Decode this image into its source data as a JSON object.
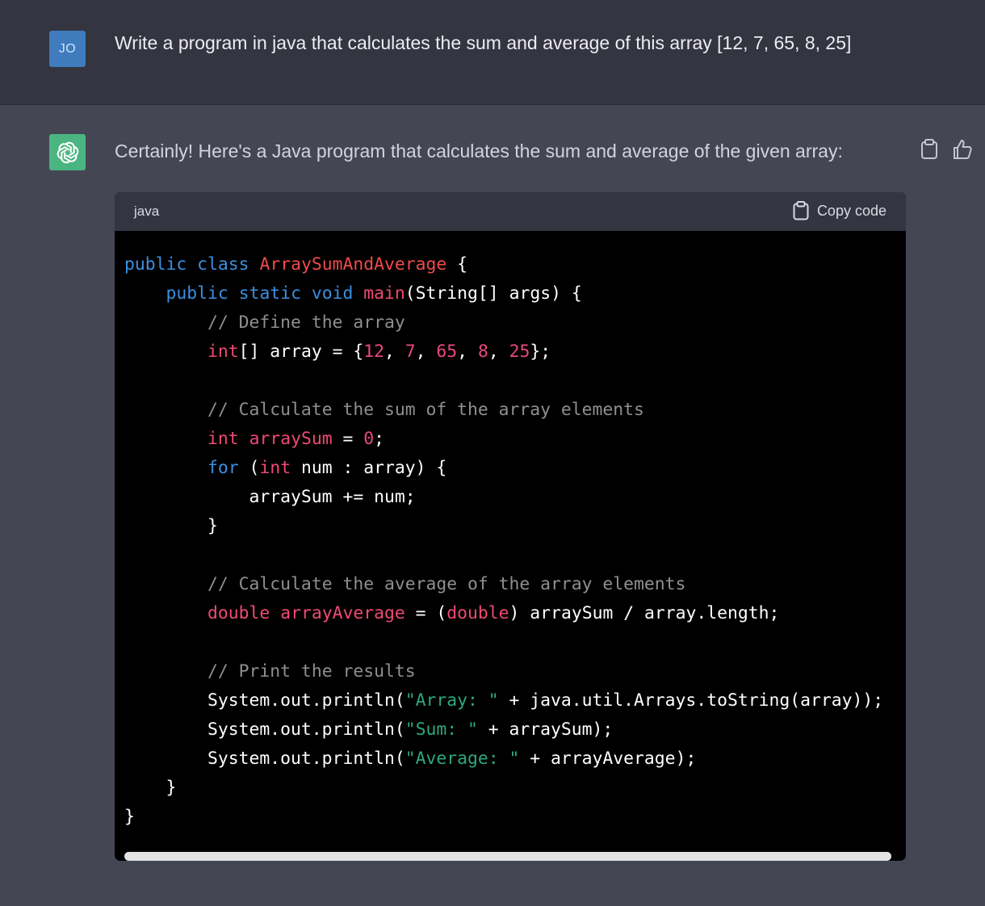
{
  "user_message": {
    "avatar_initials": "JO",
    "text": "Write a program in java that calculates the sum and average of this array [12, 7, 65, 8, 25]"
  },
  "assistant_message": {
    "intro": "Certainly! Here's a Java program that calculates the sum and average of the given array:",
    "code_block": {
      "language": "java",
      "copy_label": "Copy code",
      "lines": [
        [
          {
            "t": "kw",
            "v": "public"
          },
          {
            "t": "plain",
            "v": " "
          },
          {
            "t": "kw",
            "v": "class"
          },
          {
            "t": "plain",
            "v": " "
          },
          {
            "t": "cls",
            "v": "ArraySumAndAverage"
          },
          {
            "t": "plain",
            "v": " {"
          }
        ],
        [
          {
            "t": "plain",
            "v": "    "
          },
          {
            "t": "kw",
            "v": "public"
          },
          {
            "t": "plain",
            "v": " "
          },
          {
            "t": "kw",
            "v": "static"
          },
          {
            "t": "plain",
            "v": " "
          },
          {
            "t": "kw",
            "v": "void"
          },
          {
            "t": "plain",
            "v": " "
          },
          {
            "t": "type",
            "v": "main"
          },
          {
            "t": "plain",
            "v": "(String[] args) {"
          }
        ],
        [
          {
            "t": "plain",
            "v": "        "
          },
          {
            "t": "com",
            "v": "// Define the array"
          }
        ],
        [
          {
            "t": "plain",
            "v": "        "
          },
          {
            "t": "type",
            "v": "int"
          },
          {
            "t": "plain",
            "v": "[] array = {"
          },
          {
            "t": "num",
            "v": "12"
          },
          {
            "t": "plain",
            "v": ", "
          },
          {
            "t": "num",
            "v": "7"
          },
          {
            "t": "plain",
            "v": ", "
          },
          {
            "t": "num",
            "v": "65"
          },
          {
            "t": "plain",
            "v": ", "
          },
          {
            "t": "num",
            "v": "8"
          },
          {
            "t": "plain",
            "v": ", "
          },
          {
            "t": "num",
            "v": "25"
          },
          {
            "t": "plain",
            "v": "};"
          }
        ],
        [],
        [
          {
            "t": "plain",
            "v": "        "
          },
          {
            "t": "com",
            "v": "// Calculate the sum of the array elements"
          }
        ],
        [
          {
            "t": "plain",
            "v": "        "
          },
          {
            "t": "type",
            "v": "int"
          },
          {
            "t": "plain",
            "v": " "
          },
          {
            "t": "type",
            "v": "arraySum"
          },
          {
            "t": "plain",
            "v": " = "
          },
          {
            "t": "num",
            "v": "0"
          },
          {
            "t": "plain",
            "v": ";"
          }
        ],
        [
          {
            "t": "plain",
            "v": "        "
          },
          {
            "t": "kw",
            "v": "for"
          },
          {
            "t": "plain",
            "v": " ("
          },
          {
            "t": "type",
            "v": "int"
          },
          {
            "t": "plain",
            "v": " num : array) {"
          }
        ],
        [
          {
            "t": "plain",
            "v": "            arraySum += num;"
          }
        ],
        [
          {
            "t": "plain",
            "v": "        }"
          }
        ],
        [],
        [
          {
            "t": "plain",
            "v": "        "
          },
          {
            "t": "com",
            "v": "// Calculate the average of the array elements"
          }
        ],
        [
          {
            "t": "plain",
            "v": "        "
          },
          {
            "t": "type",
            "v": "double"
          },
          {
            "t": "plain",
            "v": " "
          },
          {
            "t": "type",
            "v": "arrayAverage"
          },
          {
            "t": "plain",
            "v": " = ("
          },
          {
            "t": "type",
            "v": "double"
          },
          {
            "t": "plain",
            "v": ") arraySum / array.length;"
          }
        ],
        [],
        [
          {
            "t": "plain",
            "v": "        "
          },
          {
            "t": "com",
            "v": "// Print the results"
          }
        ],
        [
          {
            "t": "plain",
            "v": "        System.out.println("
          },
          {
            "t": "str",
            "v": "\"Array: \""
          },
          {
            "t": "plain",
            "v": " + java.util.Arrays.toString(array));"
          }
        ],
        [
          {
            "t": "plain",
            "v": "        System.out.println("
          },
          {
            "t": "str",
            "v": "\"Sum: \""
          },
          {
            "t": "plain",
            "v": " + arraySum);"
          }
        ],
        [
          {
            "t": "plain",
            "v": "        System.out.println("
          },
          {
            "t": "str",
            "v": "\"Average: \""
          },
          {
            "t": "plain",
            "v": " + arrayAverage);"
          }
        ],
        [
          {
            "t": "plain",
            "v": "    }"
          }
        ],
        [
          {
            "t": "plain",
            "v": "}"
          }
        ]
      ]
    },
    "actions": {
      "copy_icon": "clipboard-icon",
      "thumbs_up_icon": "thumbs-up-icon"
    }
  },
  "colors": {
    "user_bg": "#343541",
    "assistant_bg": "#444654",
    "user_avatar": "#3f7bbd",
    "bot_avatar": "#4bb582",
    "keyword": "#3a8fe0",
    "type": "#ef4a73",
    "class_name": "#ef4a4a",
    "comment": "#8f8f8f",
    "number": "#e9497c",
    "string": "#2ea87c"
  }
}
